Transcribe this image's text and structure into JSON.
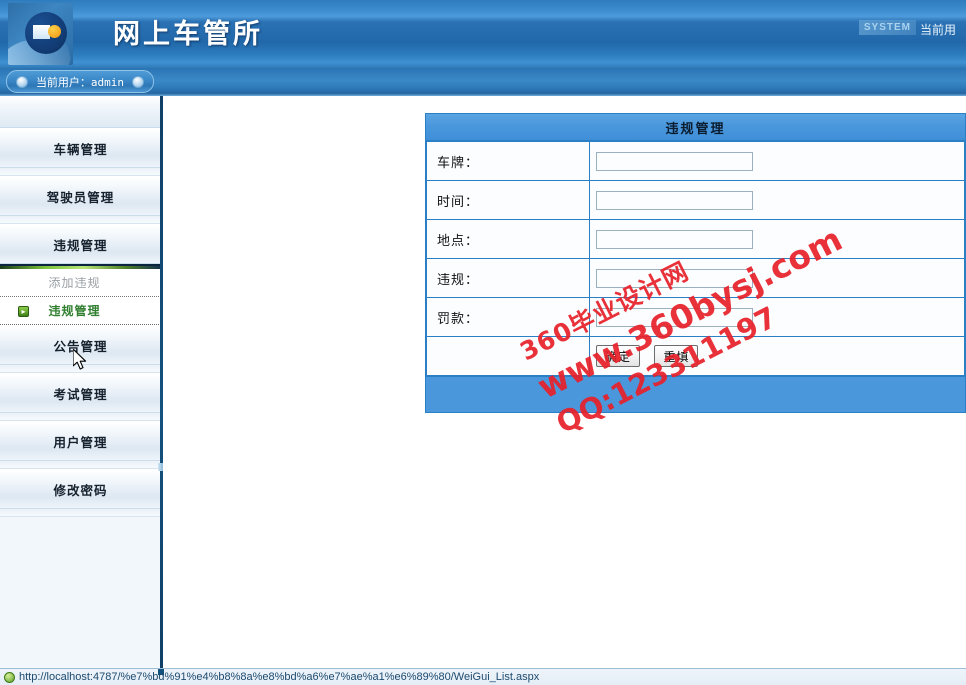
{
  "header": {
    "title": "网上车管所",
    "system_badge": "SYSTEM",
    "right_user_text": "当前用",
    "logo_icon": "disc-logo-icon"
  },
  "userbar": {
    "label": "当前用户：admin",
    "left_knob_icon": "knob-icon",
    "right_knob_icon": "knob-icon"
  },
  "sidebar": {
    "items": [
      {
        "label": "车辆管理"
      },
      {
        "label": "驾驶员管理"
      },
      {
        "label": "违规管理"
      },
      {
        "label": "公告管理"
      },
      {
        "label": "考试管理"
      },
      {
        "label": "用户管理"
      },
      {
        "label": "修改密码"
      }
    ],
    "submenu": [
      {
        "label": "添加违规",
        "active": false
      },
      {
        "label": "违规管理",
        "active": true
      }
    ],
    "bullet_icon": "arrow-right-bullet-icon",
    "cursor_icon": "mouse-pointer-icon"
  },
  "form": {
    "title": "违规管理",
    "rows": [
      {
        "label": "车牌：",
        "value": "",
        "placeholder": ""
      },
      {
        "label": "时间：",
        "value": "",
        "placeholder": ""
      },
      {
        "label": "地点：",
        "value": "",
        "placeholder": ""
      },
      {
        "label": "违规：",
        "value": "",
        "placeholder": ""
      },
      {
        "label": "罚款：",
        "value": "",
        "placeholder": ""
      }
    ],
    "submit_label": "确定",
    "reset_label": "重填"
  },
  "watermark": {
    "line1": "360毕业设计网",
    "line2": "www.360bysj.com",
    "line3": "QQ:123311197",
    "color": "#e8202a"
  },
  "statusbar": {
    "url": "http://localhost:4787/%e7%bd%91%e4%b8%8a%e8%bd%a6%e7%ae%a1%e6%89%80/WeiGui_List.aspx",
    "icon": "globe-icon"
  },
  "colors": {
    "header_blue": "#2168aa",
    "panel_blue": "#4a97dc",
    "panel_border": "#2b7fc4",
    "active_green": "#2f7f2f",
    "watermark_red": "#e8202a"
  }
}
